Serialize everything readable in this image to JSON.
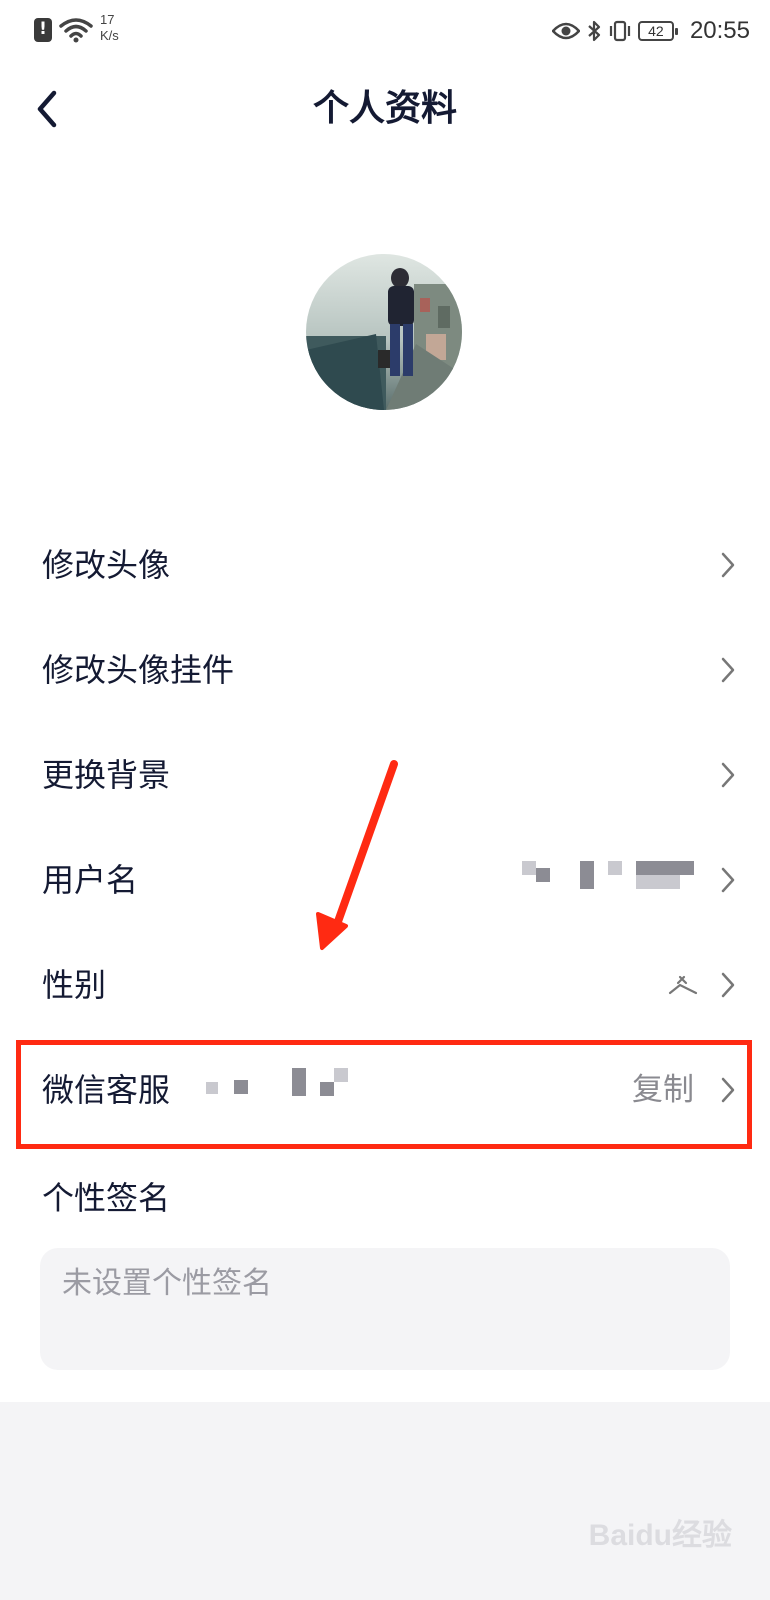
{
  "status_bar": {
    "network_speed_value": "17",
    "network_speed_unit": "K/s",
    "battery": "42",
    "time": "20:55",
    "icons": [
      "alert-icon",
      "wifi-icon",
      "eye-icon",
      "bluetooth-icon",
      "vibrate-icon",
      "battery-icon"
    ]
  },
  "header": {
    "title": "个人资料",
    "back_icon": "chevron-left-icon"
  },
  "avatar": {
    "description_icon": "avatar-photo"
  },
  "menu": {
    "items": [
      {
        "label": "修改头像"
      },
      {
        "label": "修改头像挂件"
      },
      {
        "label": "更换背景"
      },
      {
        "label": "用户名"
      },
      {
        "label": "性别"
      },
      {
        "label": "微信客服",
        "action": "复制"
      }
    ]
  },
  "signature": {
    "label": "个性签名",
    "placeholder": "未设置个性签名"
  },
  "watermark": "Baidu经验",
  "colors": {
    "title": "#141a33",
    "highlight": "#ff2a12",
    "secondary_text": "#8a8a90",
    "input_bg": "#f4f4f6"
  }
}
